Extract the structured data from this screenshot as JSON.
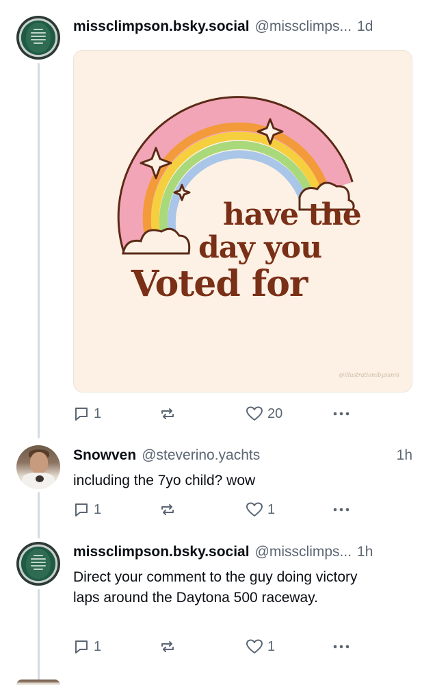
{
  "posts": [
    {
      "display_name": "missclimpson.bsky.social",
      "handle": "@missclimps...",
      "time": "1d",
      "avatar": "seal-avatar",
      "image": {
        "lines": [
          "have the",
          "day you",
          "Voted for"
        ],
        "watermark": "@illustrationsbysunni"
      },
      "counts": {
        "reply": "1",
        "like": "20"
      }
    },
    {
      "display_name": "Snowven",
      "handle": "@steverino.yachts",
      "time": "1h",
      "avatar": "photo-avatar",
      "text": "including the 7yo child? wow",
      "counts": {
        "reply": "1",
        "like": "1"
      }
    },
    {
      "display_name": "missclimpson.bsky.social",
      "handle": "@missclimps...",
      "time": "1h",
      "avatar": "seal-avatar",
      "text": "Direct your comment to the guy doing victory laps around the Daytona 500 raceway.",
      "counts": {
        "reply": "1",
        "like": "1"
      }
    }
  ],
  "icons": {
    "reply": "reply-icon",
    "repost": "repost-icon",
    "like": "heart-icon",
    "more": "more-icon"
  },
  "colors": {
    "text": "#0b0f14",
    "muted": "#5b6673",
    "thread_line": "#d4dbe2",
    "image_bg": "#fcf1e4",
    "image_text": "#7a2f17"
  }
}
